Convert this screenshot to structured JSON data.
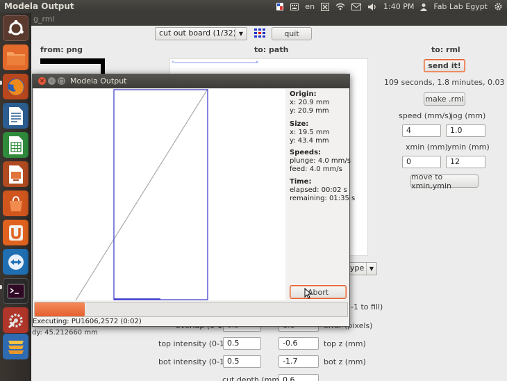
{
  "top_panel": {
    "window_title": "Modela Output",
    "keyboard_layout": "en",
    "clock": "1:40 PM",
    "user": "Fab Lab Egypt"
  },
  "launcher": {
    "items": [
      "ubuntu-dash",
      "files",
      "firefox",
      "libreoffice-writer",
      "libreoffice-calc",
      "libreoffice-impress",
      "software-center",
      "ubuntu-one",
      "teamviewer",
      "terminal",
      "system-settings",
      "workspace"
    ]
  },
  "main_window": {
    "title_fragment": "g_rml",
    "board_select": "cut out board (1/32)",
    "quit_label": "quit",
    "headers": {
      "from": "from: png",
      "to_path": "to: path",
      "to_rml": "to: rml"
    },
    "send_label": "send it!",
    "estimate": "109 seconds, 1.8 minutes, 0.03 hours",
    "make_rml_label": "make .rml",
    "speed_label": "speed (mm/s)",
    "jog_label": "jog (mm)",
    "speed_value": "4",
    "jog_value": "1.0",
    "xmin_label": "xmin (mm)",
    "ymin_label": "ymin (mm)",
    "xmin_value": "0",
    "ymin_value": "12",
    "move_label": "move to xmin,ymin",
    "type_select_fragment": "ype",
    "fill_fragment": "-1 to fill)",
    "overlap_label": "overlap (0-1)",
    "overlap_value": "0.5",
    "error_value": "1.1",
    "error_label": "error (pixels)",
    "top_intensity_label": "top intensity (0-1)",
    "top_intensity_value": "0.5",
    "top_z_value": "-0.6",
    "top_z_label": "top z (mm)",
    "bot_intensity_label": "bot intensity (0-1)",
    "bot_intensity_value": "0.5",
    "bot_z_value": "-1.7",
    "bot_z_label": "bot z (mm)",
    "cut_depth_label": "cut depth (mm)",
    "cut_depth_value": "0.6",
    "dy_text": "dy: 45.212660 mm"
  },
  "dialog": {
    "title": "Modela Output",
    "origin_title": "Origin:",
    "origin_x": "x: 20.9 mm",
    "origin_y": "y: 20.9 mm",
    "size_title": "Size:",
    "size_x": "x: 19.5 mm",
    "size_y": "y: 43.4 mm",
    "speeds_title": "Speeds:",
    "plunge": "plunge: 4.0 mm/s",
    "feed": "feed: 4.0 mm/s",
    "time_title": "Time:",
    "elapsed": "elapsed: 00:02 s",
    "remaining": "remaining: 01:35 s",
    "abort_label": "Abort",
    "progress_percent": 16,
    "status": "Executing: PU1606,2572 (0:02)"
  },
  "colors": {
    "accent": "#e5612f",
    "panel": "#3c3b37",
    "toolpath": "#3333cc"
  }
}
